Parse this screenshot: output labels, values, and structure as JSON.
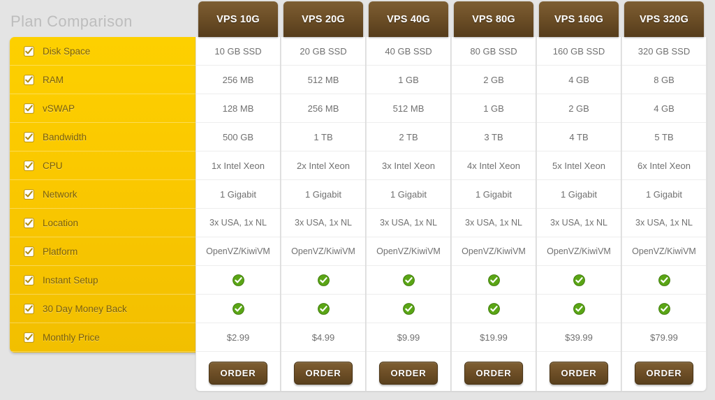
{
  "page": {
    "title": "Plan Comparison",
    "background_color": "#e4e4e4",
    "title_color": "#bdbdbd"
  },
  "colors": {
    "sidebar_yellow_top": "#fdd000",
    "sidebar_yellow_bottom": "#f2bf00",
    "header_brown_top": "#7d5e33",
    "header_brown_bottom": "#553c1b",
    "order_button_brown": "#6d4e26",
    "check_green": "#5aa515",
    "cell_text": "#707070",
    "feature_label": "#7a5f08"
  },
  "sidebar": {
    "items": [
      {
        "label": "Disk Space",
        "icon": "checkbox-checked-icon"
      },
      {
        "label": "RAM",
        "icon": "checkbox-checked-icon"
      },
      {
        "label": "vSWAP",
        "icon": "checkbox-checked-icon"
      },
      {
        "label": "Bandwidth",
        "icon": "checkbox-checked-icon"
      },
      {
        "label": "CPU",
        "icon": "checkbox-checked-icon"
      },
      {
        "label": "Network",
        "icon": "checkbox-checked-icon"
      },
      {
        "label": "Location",
        "icon": "checkbox-checked-icon"
      },
      {
        "label": "Platform",
        "icon": "checkbox-checked-icon"
      },
      {
        "label": "Instant Setup",
        "icon": "checkbox-checked-icon"
      },
      {
        "label": "30 Day Money Back",
        "icon": "checkbox-checked-icon"
      },
      {
        "label": "Monthly Price",
        "icon": "checkbox-checked-icon"
      }
    ]
  },
  "table": {
    "order_label": "ORDER",
    "check_icon": "green-check-icon",
    "row_names": [
      "Disk Space",
      "RAM",
      "vSWAP",
      "Bandwidth",
      "CPU",
      "Network",
      "Location",
      "Platform",
      "Instant Setup",
      "30 Day Money Back",
      "Monthly Price"
    ],
    "plans": [
      {
        "name": "VPS 10G",
        "disk_space": "10 GB SSD",
        "ram": "256 MB",
        "vswap": "128 MB",
        "bandwidth": "500 GB",
        "cpu": "1x Intel Xeon",
        "network": "1 Gigabit",
        "location": "3x USA, 1x NL",
        "platform": "OpenVZ/KiwiVM",
        "instant_setup": "yes",
        "money_back": "yes",
        "price": "$2.99",
        "order": "ORDER"
      },
      {
        "name": "VPS 20G",
        "disk_space": "20 GB SSD",
        "ram": "512 MB",
        "vswap": "256 MB",
        "bandwidth": "1 TB",
        "cpu": "2x Intel Xeon",
        "network": "1 Gigabit",
        "location": "3x USA, 1x NL",
        "platform": "OpenVZ/KiwiVM",
        "instant_setup": "yes",
        "money_back": "yes",
        "price": "$4.99",
        "order": "ORDER"
      },
      {
        "name": "VPS 40G",
        "disk_space": "40 GB SSD",
        "ram": "1 GB",
        "vswap": "512 MB",
        "bandwidth": "2 TB",
        "cpu": "3x Intel Xeon",
        "network": "1 Gigabit",
        "location": "3x USA, 1x NL",
        "platform": "OpenVZ/KiwiVM",
        "instant_setup": "yes",
        "money_back": "yes",
        "price": "$9.99",
        "order": "ORDER"
      },
      {
        "name": "VPS 80G",
        "disk_space": "80 GB SSD",
        "ram": "2 GB",
        "vswap": "1 GB",
        "bandwidth": "3 TB",
        "cpu": "4x Intel Xeon",
        "network": "1 Gigabit",
        "location": "3x USA, 1x NL",
        "platform": "OpenVZ/KiwiVM",
        "instant_setup": "yes",
        "money_back": "yes",
        "price": "$19.99",
        "order": "ORDER"
      },
      {
        "name": "VPS 160G",
        "disk_space": "160 GB SSD",
        "ram": "4 GB",
        "vswap": "2 GB",
        "bandwidth": "4 TB",
        "cpu": "5x Intel Xeon",
        "network": "1 Gigabit",
        "location": "3x USA, 1x NL",
        "platform": "OpenVZ/KiwiVM",
        "instant_setup": "yes",
        "money_back": "yes",
        "price": "$39.99",
        "order": "ORDER"
      },
      {
        "name": "VPS 320G",
        "disk_space": "320 GB SSD",
        "ram": "8 GB",
        "vswap": "4 GB",
        "bandwidth": "5 TB",
        "cpu": "6x Intel Xeon",
        "network": "1 Gigabit",
        "location": "3x USA, 1x NL",
        "platform": "OpenVZ/KiwiVM",
        "instant_setup": "yes",
        "money_back": "yes",
        "price": "$79.99",
        "order": "ORDER"
      }
    ]
  }
}
